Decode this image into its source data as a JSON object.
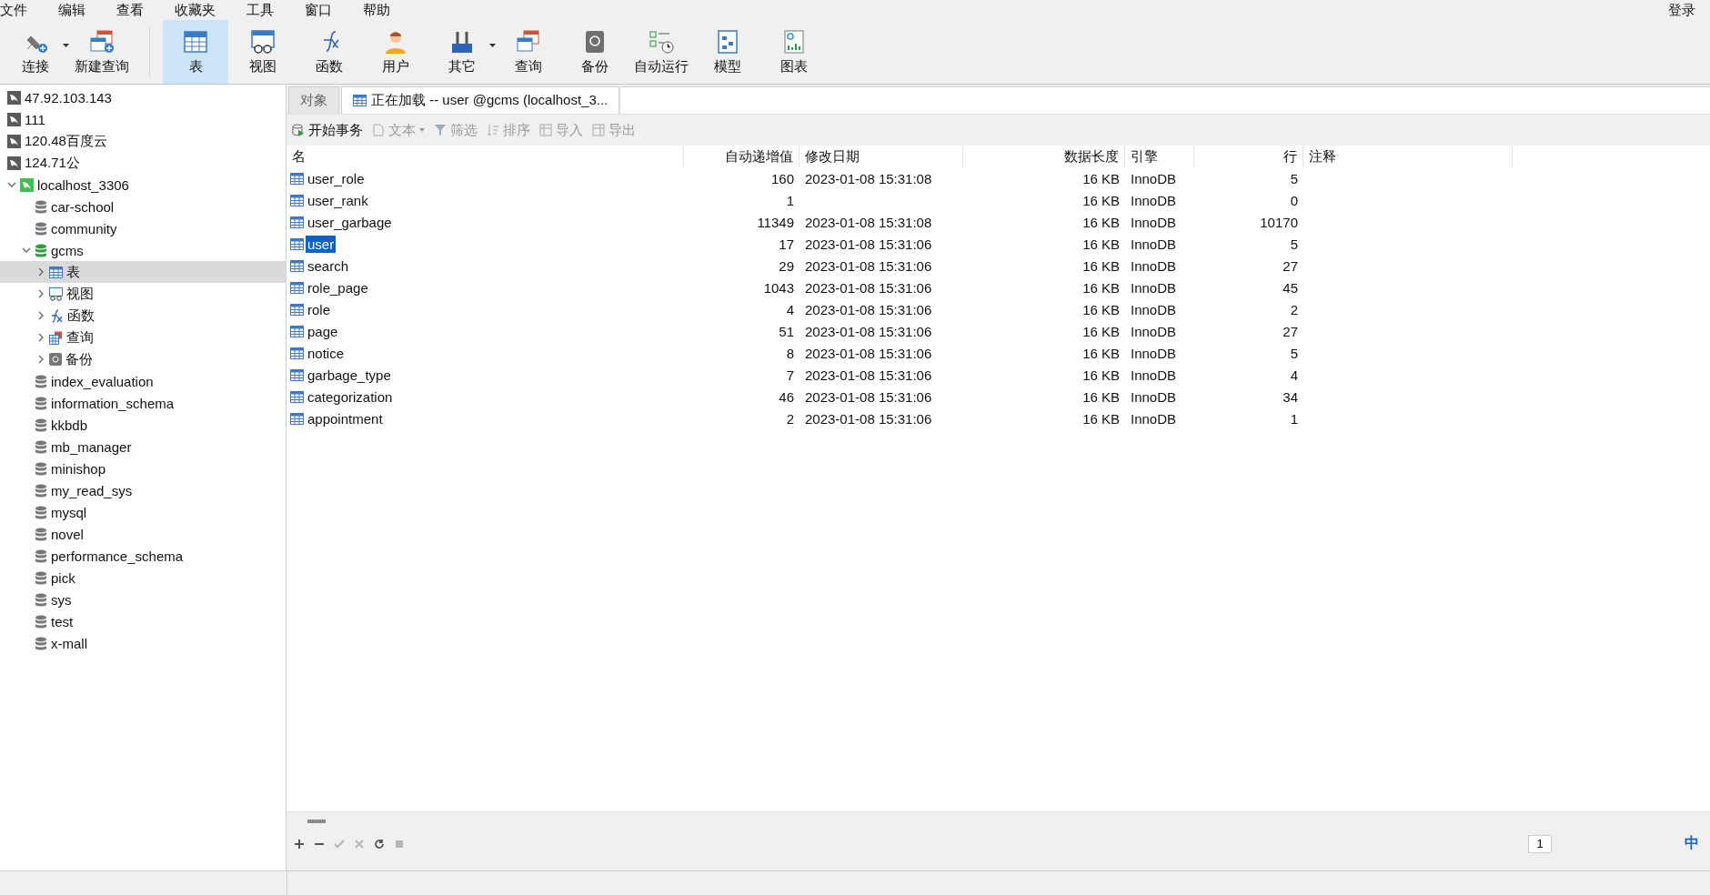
{
  "menu": [
    "文件",
    "编辑",
    "查看",
    "收藏夹",
    "工具",
    "窗口",
    "帮助"
  ],
  "login": "登录",
  "toolbar": [
    {
      "kind": "connect",
      "label": "连接",
      "selected": false,
      "has_menu": true
    },
    {
      "kind": "new-query",
      "label": "新建查询",
      "selected": false,
      "has_menu": false
    },
    {
      "kind": "table",
      "label": "表",
      "selected": true,
      "has_menu": false
    },
    {
      "kind": "view",
      "label": "视图",
      "selected": false,
      "has_menu": false
    },
    {
      "kind": "function",
      "label": "函数",
      "selected": false,
      "has_menu": false
    },
    {
      "kind": "user",
      "label": "用户",
      "selected": false,
      "has_menu": false
    },
    {
      "kind": "other",
      "label": "其它",
      "selected": false,
      "has_menu": true
    },
    {
      "kind": "query",
      "label": "查询",
      "selected": false,
      "has_menu": false
    },
    {
      "kind": "backup",
      "label": "备份",
      "selected": false,
      "has_menu": false
    },
    {
      "kind": "schedule",
      "label": "自动运行",
      "selected": false,
      "has_menu": false
    },
    {
      "kind": "model",
      "label": "模型",
      "selected": false,
      "has_menu": false
    },
    {
      "kind": "chart",
      "label": "图表",
      "selected": false,
      "has_menu": false
    }
  ],
  "sidebar": [
    {
      "kind": "server",
      "label": "47.92.103.143",
      "connected": false,
      "selected": false
    },
    {
      "kind": "server",
      "label": "111",
      "connected": false,
      "selected": false
    },
    {
      "kind": "server",
      "label": "120.48百度云",
      "connected": false,
      "selected": false
    },
    {
      "kind": "server",
      "label": "124.71公",
      "connected": false,
      "selected": false
    },
    {
      "kind": "server",
      "label": "localhost_3306",
      "connected": true,
      "selected": false,
      "expanded": true,
      "children": [
        {
          "kind": "database",
          "label": "car-school",
          "connected": false,
          "selected": false
        },
        {
          "kind": "database",
          "label": "community",
          "connected": false,
          "selected": false
        },
        {
          "kind": "database",
          "label": "gcms",
          "connected": true,
          "selected": false,
          "expanded": true,
          "children": [
            {
              "kind": "tables",
              "label": "表",
              "selected": true,
              "expanded": false
            },
            {
              "kind": "views",
              "label": "视图",
              "selected": false,
              "expanded": false
            },
            {
              "kind": "functions",
              "label": "函数",
              "selected": false,
              "expanded": false
            },
            {
              "kind": "queries",
              "label": "查询",
              "selected": false,
              "expanded": false
            },
            {
              "kind": "backups",
              "label": "备份",
              "selected": false,
              "expanded": false
            }
          ]
        },
        {
          "kind": "database",
          "label": "index_evaluation",
          "connected": false,
          "selected": false
        },
        {
          "kind": "database",
          "label": "information_schema",
          "connected": false,
          "selected": false
        },
        {
          "kind": "database",
          "label": "kkbdb",
          "connected": false,
          "selected": false
        },
        {
          "kind": "database",
          "label": "mb_manager",
          "connected": false,
          "selected": false
        },
        {
          "kind": "database",
          "label": "minishop",
          "connected": false,
          "selected": false
        },
        {
          "kind": "database",
          "label": "my_read_sys",
          "connected": false,
          "selected": false
        },
        {
          "kind": "database",
          "label": "mysql",
          "connected": false,
          "selected": false
        },
        {
          "kind": "database",
          "label": "novel",
          "connected": false,
          "selected": false
        },
        {
          "kind": "database",
          "label": "performance_schema",
          "connected": false,
          "selected": false
        },
        {
          "kind": "database",
          "label": "pick",
          "connected": false,
          "selected": false
        },
        {
          "kind": "database",
          "label": "sys",
          "connected": false,
          "selected": false
        },
        {
          "kind": "database",
          "label": "test",
          "connected": false,
          "selected": false
        },
        {
          "kind": "database",
          "label": "x-mall",
          "connected": false,
          "selected": false
        }
      ]
    }
  ],
  "tabs": [
    {
      "label": "对象",
      "selected": false,
      "icon": false
    },
    {
      "label": "正在加载 -- user @gcms (localhost_3...",
      "selected": true,
      "icon": true
    }
  ],
  "actions": [
    {
      "kind": "transaction",
      "label": "开始事务",
      "disabled": false,
      "has_menu": false
    },
    {
      "kind": "text",
      "label": "文本",
      "disabled": true,
      "has_menu": true
    },
    {
      "kind": "filter",
      "label": "筛选",
      "disabled": true,
      "has_menu": false
    },
    {
      "kind": "sort",
      "label": "排序",
      "disabled": true,
      "has_menu": false
    },
    {
      "kind": "import",
      "label": "导入",
      "disabled": true,
      "has_menu": false
    },
    {
      "kind": "export",
      "label": "导出",
      "disabled": true,
      "has_menu": false
    }
  ],
  "table": {
    "columns": [
      "名",
      "自动递增值",
      "修改日期",
      "数据长度",
      "引擎",
      "行",
      "注释"
    ],
    "rows": [
      {
        "cells": [
          "user_role",
          "160",
          "2023-01-08 15:31:08",
          "16 KB",
          "InnoDB",
          "5"
        ],
        "selected": false
      },
      {
        "cells": [
          "user_rank",
          "1",
          "",
          "16 KB",
          "InnoDB",
          "0"
        ],
        "selected": false
      },
      {
        "cells": [
          "user_garbage",
          "11349",
          "2023-01-08 15:31:08",
          "16 KB",
          "InnoDB",
          "10170"
        ],
        "selected": false
      },
      {
        "cells": [
          "user",
          "17",
          "2023-01-08 15:31:06",
          "16 KB",
          "InnoDB",
          "5"
        ],
        "selected": true
      },
      {
        "cells": [
          "search",
          "29",
          "2023-01-08 15:31:06",
          "16 KB",
          "InnoDB",
          "27"
        ],
        "selected": false
      },
      {
        "cells": [
          "role_page",
          "1043",
          "2023-01-08 15:31:06",
          "16 KB",
          "InnoDB",
          "45"
        ],
        "selected": false
      },
      {
        "cells": [
          "role",
          "4",
          "2023-01-08 15:31:06",
          "16 KB",
          "InnoDB",
          "2"
        ],
        "selected": false
      },
      {
        "cells": [
          "page",
          "51",
          "2023-01-08 15:31:06",
          "16 KB",
          "InnoDB",
          "27"
        ],
        "selected": false
      },
      {
        "cells": [
          "notice",
          "8",
          "2023-01-08 15:31:06",
          "16 KB",
          "InnoDB",
          "5"
        ],
        "selected": false
      },
      {
        "cells": [
          "garbage_type",
          "7",
          "2023-01-08 15:31:06",
          "16 KB",
          "InnoDB",
          "4"
        ],
        "selected": false
      },
      {
        "cells": [
          "categorization",
          "46",
          "2023-01-08 15:31:06",
          "16 KB",
          "InnoDB",
          "34"
        ],
        "selected": false
      },
      {
        "cells": [
          "appointment",
          "2",
          "2023-01-08 15:31:06",
          "16 KB",
          "InnoDB",
          "1"
        ],
        "selected": false
      }
    ]
  },
  "bottom_tools": [
    {
      "kind": "add",
      "disabled": false
    },
    {
      "kind": "remove",
      "disabled": false
    },
    {
      "kind": "apply",
      "disabled": true
    },
    {
      "kind": "discard",
      "disabled": true
    },
    {
      "kind": "refresh",
      "disabled": false
    },
    {
      "kind": "stop",
      "disabled": true
    }
  ],
  "pager": {
    "page": "1"
  },
  "ime": {
    "label": "中"
  }
}
